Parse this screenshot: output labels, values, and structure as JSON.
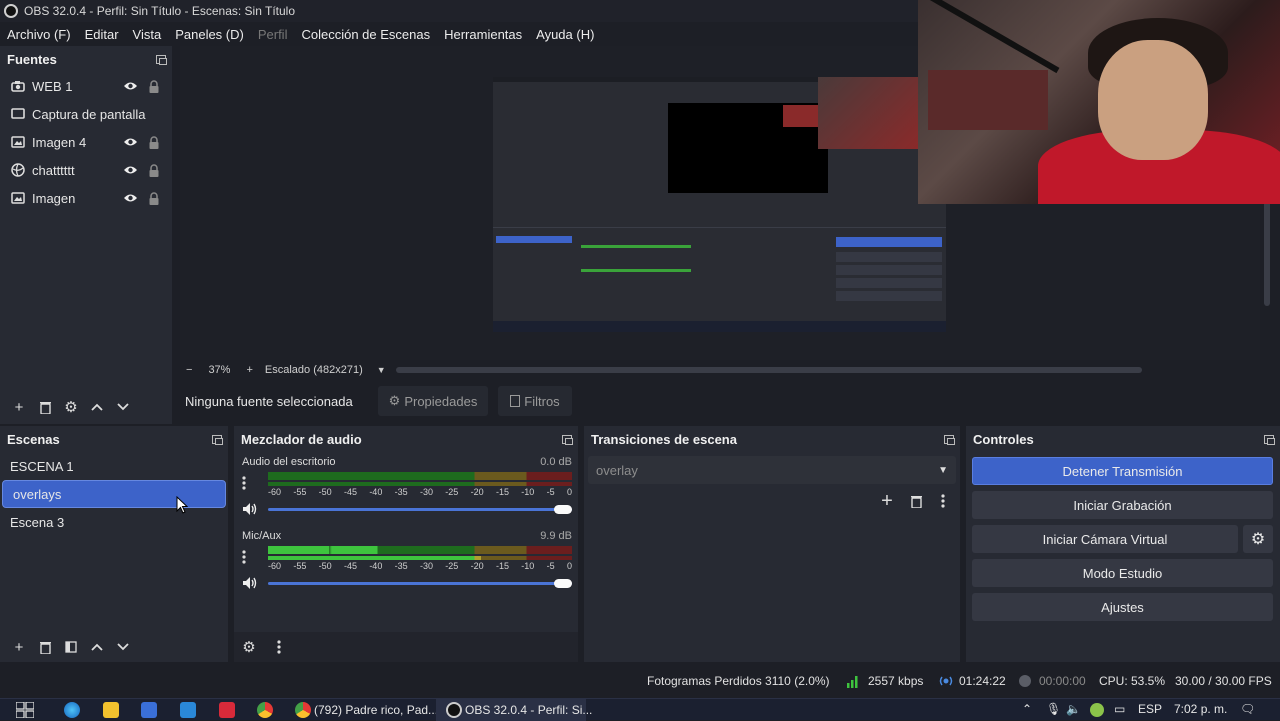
{
  "window": {
    "title": "OBS 32.0.4 - Perfil: Sin Título - Escenas: Sin Título"
  },
  "menu": [
    "Archivo (F)",
    "Editar",
    "Vista",
    "Paneles (D)",
    "Perfil",
    "Colección de Escenas",
    "Herramientas",
    "Ayuda (H)"
  ],
  "sources": {
    "title": "Fuentes",
    "items": [
      {
        "name": "WEB 1",
        "icon": "camera-icon"
      },
      {
        "name": "Captura de pantalla",
        "icon": "monitor-icon"
      },
      {
        "name": "Imagen 4",
        "icon": "image-icon"
      },
      {
        "name": "chatttttt",
        "icon": "browser-icon"
      },
      {
        "name": "Imagen",
        "icon": "image-icon"
      }
    ]
  },
  "preview": {
    "zoom": "37%",
    "scale_label": "Escalado (482x271)",
    "no_source": "Ninguna fuente seleccionada",
    "properties": "Propiedades",
    "filters": "Filtros"
  },
  "scenes": {
    "title": "Escenas",
    "items": [
      "ESCENA 1",
      "overlays",
      "Escena 3"
    ],
    "selected_index": 1
  },
  "mixer": {
    "title": "Mezclador de audio",
    "channels": [
      {
        "name": "Audio del escritorio",
        "db": "0.0 dB"
      },
      {
        "name": "Mic/Aux",
        "db": "9.9 dB"
      }
    ],
    "ticks": [
      "-60",
      "-55",
      "-50",
      "-45",
      "-40",
      "-35",
      "-30",
      "-25",
      "-20",
      "-15",
      "-10",
      "-5",
      "0"
    ]
  },
  "transitions": {
    "title": "Transiciones de escena",
    "selected": "overlay"
  },
  "controls": {
    "title": "Controles",
    "stop_stream": "Detener Transmisión",
    "start_recording": "Iniciar Grabación",
    "start_virtual_cam": "Iniciar Cámara Virtual",
    "studio_mode": "Modo Estudio",
    "settings": "Ajustes"
  },
  "status": {
    "dropped_frames": "Fotogramas Perdidos 3110 (2.0%)",
    "bitrate": "2557 kbps",
    "stream_time": "01:24:22",
    "rec_time": "00:00:00",
    "cpu": "CPU: 53.5%",
    "fps": "30.00 / 30.00 FPS"
  },
  "taskbar": {
    "chrome_tab": "(792) Padre rico, Pad...",
    "obs_tab": "OBS 32.0.4 - Perfil: Si...",
    "language": "ESP",
    "time": "7:02 p. m."
  },
  "colors": {
    "accent": "#3d63c9",
    "dock": "#272a33",
    "background": "#1d1f26"
  }
}
